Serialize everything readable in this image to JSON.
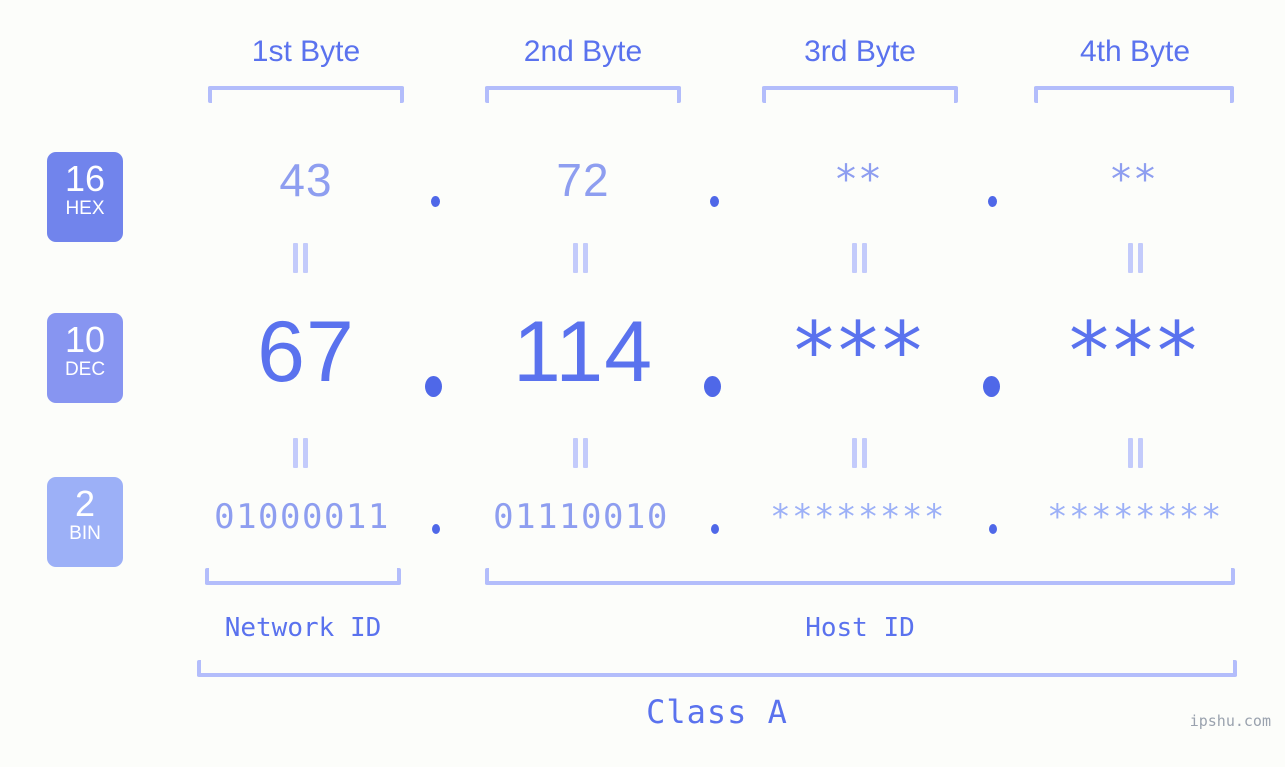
{
  "meta": {
    "background_color": "#fcfdfa",
    "accent_color": "#5a72ee",
    "accent_light_color": "#8e9ef0",
    "bracket_color": "#b3bdfb",
    "watermark": "ipshu.com"
  },
  "headers": [
    {
      "label": "1st Byte"
    },
    {
      "label": "2nd Byte"
    },
    {
      "label": "3rd Byte"
    },
    {
      "label": "4th Byte"
    }
  ],
  "rows": [
    {
      "id": "hex",
      "badge_number": "16",
      "badge_name": "HEX",
      "badge_color": "#7184ec",
      "values": [
        "43",
        "72",
        "**",
        "**"
      ],
      "separators": [
        ".",
        ".",
        "."
      ]
    },
    {
      "id": "dec",
      "badge_number": "10",
      "badge_name": "DEC",
      "badge_color": "#8795f1",
      "values": [
        "67",
        "114",
        "***",
        "***"
      ],
      "separators": [
        ".",
        ".",
        "."
      ]
    },
    {
      "id": "bin",
      "badge_number": "2",
      "badge_name": "BIN",
      "badge_color": "#9cb0f7",
      "values": [
        "01000011",
        "01110010",
        "********",
        "********"
      ],
      "separators": [
        ".",
        ".",
        "."
      ]
    }
  ],
  "equals_marks": {
    "glyph": "||",
    "count_per_row": 4
  },
  "segments": {
    "network_id": "Network ID",
    "host_id": "Host ID"
  },
  "class_label": "Class A"
}
